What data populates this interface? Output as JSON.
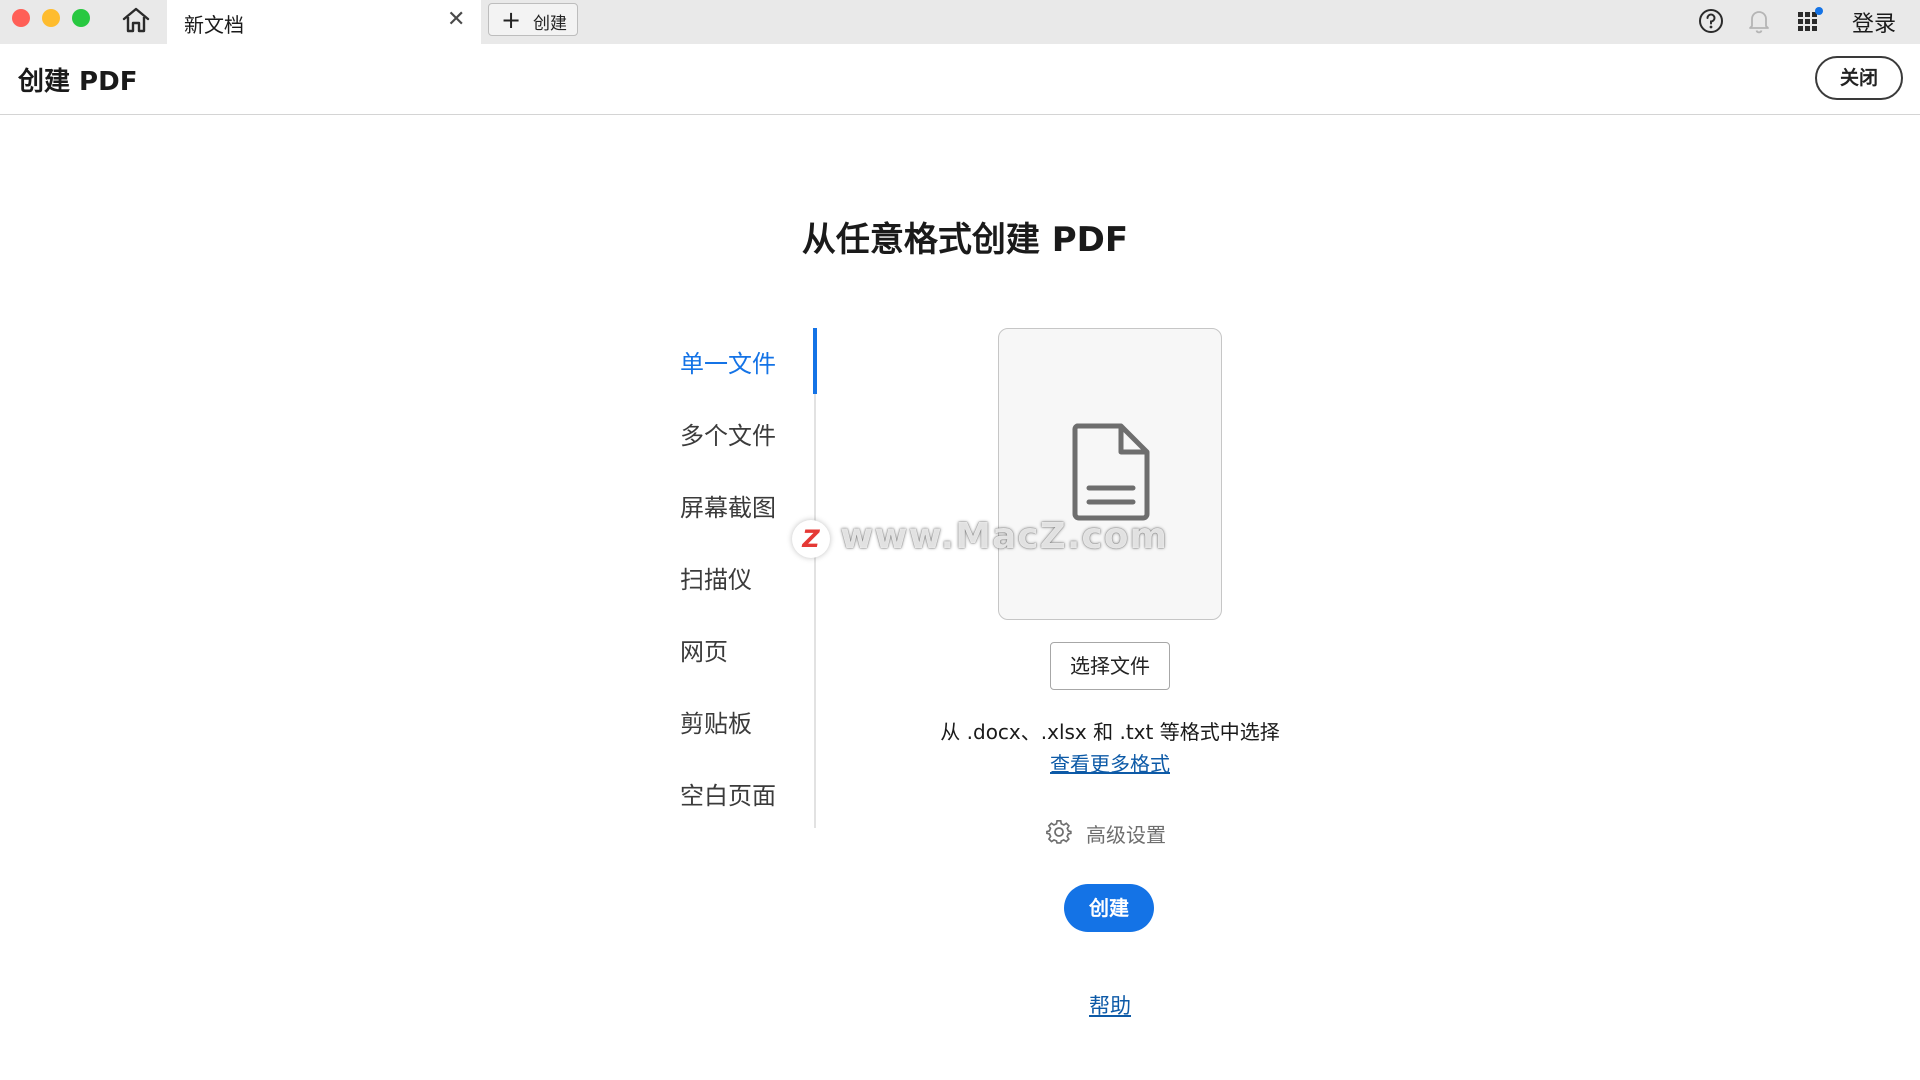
{
  "tabbar": {
    "doc_tab_title": "新文档",
    "close_tab_glyph": "✕",
    "new_tab_plus": "+",
    "new_tab_label": "创建",
    "sign_in": "登录",
    "notification_dot_color": "#1473e6"
  },
  "header": {
    "title": "创建 PDF",
    "close_label": "关闭"
  },
  "main": {
    "heading": "从任意格式创建 PDF",
    "nav": [
      {
        "label": "单一文件",
        "active": true
      },
      {
        "label": "多个文件",
        "active": false
      },
      {
        "label": "屏幕截图",
        "active": false
      },
      {
        "label": "扫描仪",
        "active": false
      },
      {
        "label": "网页",
        "active": false
      },
      {
        "label": "剪贴板",
        "active": false
      },
      {
        "label": "空白页面",
        "active": false
      }
    ],
    "select_file_label": "选择文件",
    "formats_note": "从 .docx、.xlsx 和 .txt 等格式中选择",
    "more_formats_link": "查看更多格式",
    "advanced_settings_label": "高级设置",
    "create_label": "创建",
    "help_link": "帮助"
  },
  "watermark": {
    "logo_letter": "Z",
    "text": "www.MacZ.com"
  },
  "colors": {
    "accent": "#1473e6",
    "link": "#0d5aa7"
  }
}
